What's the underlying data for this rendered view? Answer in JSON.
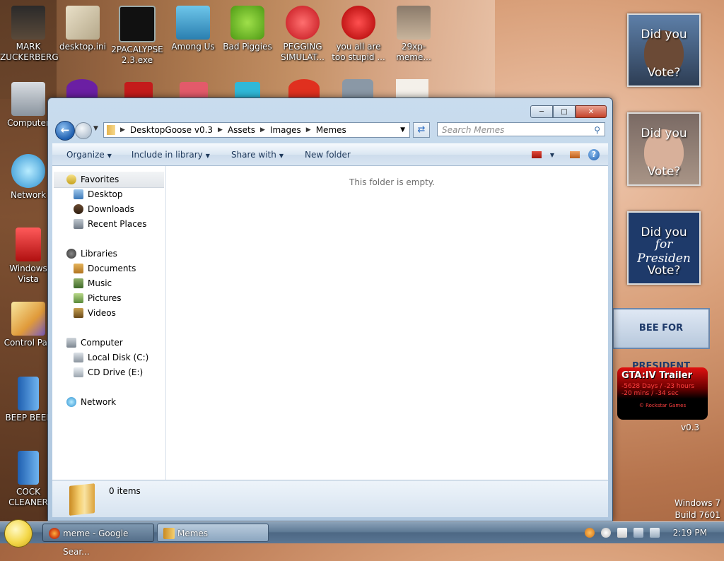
{
  "desktop": {
    "icons_top": [
      {
        "label_l1": "MARK",
        "label_l2": "ZUCKERBERG",
        "icon": "person-icon"
      },
      {
        "label_l1": "desktop.ini",
        "label_l2": "",
        "icon": "settings-file-icon"
      },
      {
        "label_l1": "2PACALYPSE",
        "label_l2": "2.3.exe",
        "icon": "console-icon"
      },
      {
        "label_l1": "Among Us",
        "label_l2": "",
        "icon": "game-icon"
      },
      {
        "label_l1": "Bad Piggies",
        "label_l2": "",
        "icon": "pig-icon"
      },
      {
        "label_l1": "PEGGING",
        "label_l2": "SIMULAT...",
        "icon": "p-logo-icon"
      },
      {
        "label_l1": "you all are",
        "label_l2": "too stupid ...",
        "icon": "dev-cpp-icon"
      },
      {
        "label_l1": "29xp-meme...",
        "label_l2": "",
        "icon": "photo-icon"
      }
    ],
    "icons_left": [
      {
        "label_l1": "Computer",
        "label_l2": "",
        "icon": "computer-icon"
      },
      {
        "label_l1": "Network",
        "label_l2": "",
        "icon": "network-globe-icon"
      },
      {
        "label_l1": "Windows",
        "label_l2": "Vista",
        "icon": "recycle-bin-icon"
      },
      {
        "label_l1": "Control Pan",
        "label_l2": "",
        "icon": "control-panel-icon"
      },
      {
        "label_l1": "BEEP BEEP",
        "label_l2": "",
        "icon": "blue-shortcut-icon"
      },
      {
        "label_l1": "COCK",
        "label_l2": "CLEANER",
        "icon": "blue-shortcut-icon"
      }
    ],
    "hidden_label_l1": "v0.3"
  },
  "gadgets": {
    "vote1_top": "Did you",
    "vote1_bottom": "Vote?",
    "vote2_top": "Did you",
    "vote2_bottom": "Vote?",
    "vote3_top": "Did you",
    "vote3_mid": "for Presiden",
    "vote3_bottom": "Vote?",
    "president_banner": "BEE  FOR PRESIDENT",
    "gta_title": "GTA:IV  Trailer",
    "gta_line1": "-5628 Days / -23 hours",
    "gta_line2": "-20 mins / -34 sec",
    "gta_footer": "© Rockstar Games"
  },
  "window": {
    "title": "",
    "address": {
      "crumbs": [
        "DesktopGoose v0.3",
        "Assets",
        "Images",
        "Memes"
      ]
    },
    "search_placeholder": "Search Memes",
    "toolbar": {
      "organize": "Organize",
      "include_in_library": "Include in library",
      "share_with": "Share with",
      "new_folder": "New folder"
    },
    "nav": {
      "favorites": "Favorites",
      "desktop": "Desktop",
      "downloads": "Downloads",
      "recent_places": "Recent Places",
      "libraries": "Libraries",
      "documents": "Documents",
      "music": "Music",
      "pictures": "Pictures",
      "videos": "Videos",
      "computer": "Computer",
      "local_disk": "Local Disk (C:)",
      "cd_drive": "CD Drive (E:)",
      "network": "Network"
    },
    "empty_message": "This folder is empty.",
    "details": {
      "item_count": "0 items"
    }
  },
  "taskbar": {
    "firefox_label": "meme - Google Sear...",
    "explorer_label": "Memes",
    "clock": "2:19 PM"
  },
  "watermark": {
    "line1": "Windows 7",
    "line2": "Build 7601"
  }
}
